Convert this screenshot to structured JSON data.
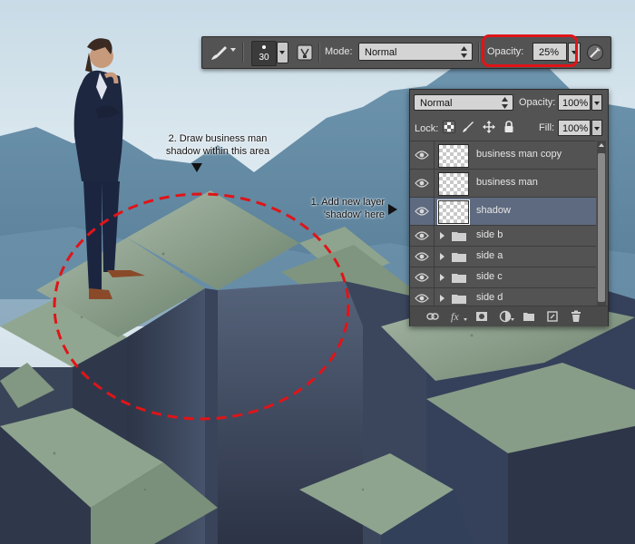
{
  "brush_bar": {
    "brush_size": "30",
    "mode_label": "Mode:",
    "mode_value": "Normal",
    "opacity_label": "Opacity:",
    "opacity_value": "25%",
    "highlight_color": "#e01418"
  },
  "layers_panel": {
    "blend_mode": "Normal",
    "opacity_label": "Opacity:",
    "opacity_value": "100%",
    "lock_label": "Lock:",
    "fill_label": "Fill:",
    "fill_value": "100%",
    "layers": [
      {
        "name": "business man copy",
        "type": "layer",
        "selected": false
      },
      {
        "name": "business man",
        "type": "layer",
        "selected": false
      },
      {
        "name": "shadow",
        "type": "layer",
        "selected": true
      },
      {
        "name": "side b",
        "type": "group",
        "selected": false
      },
      {
        "name": "side a",
        "type": "group",
        "selected": false
      },
      {
        "name": "side c",
        "type": "group",
        "selected": false
      },
      {
        "name": "side d",
        "type": "group",
        "selected": false
      }
    ],
    "selected_color": "#5e6a7f",
    "panel_color": "#535353"
  },
  "annotations": {
    "draw_area": {
      "line1": "2. Draw business man",
      "line2": "shadow within this area"
    },
    "add_layer": {
      "line1": "1. Add new layer",
      "line2": "'shadow' here"
    }
  },
  "dashed_ellipse_color": "#e01418"
}
